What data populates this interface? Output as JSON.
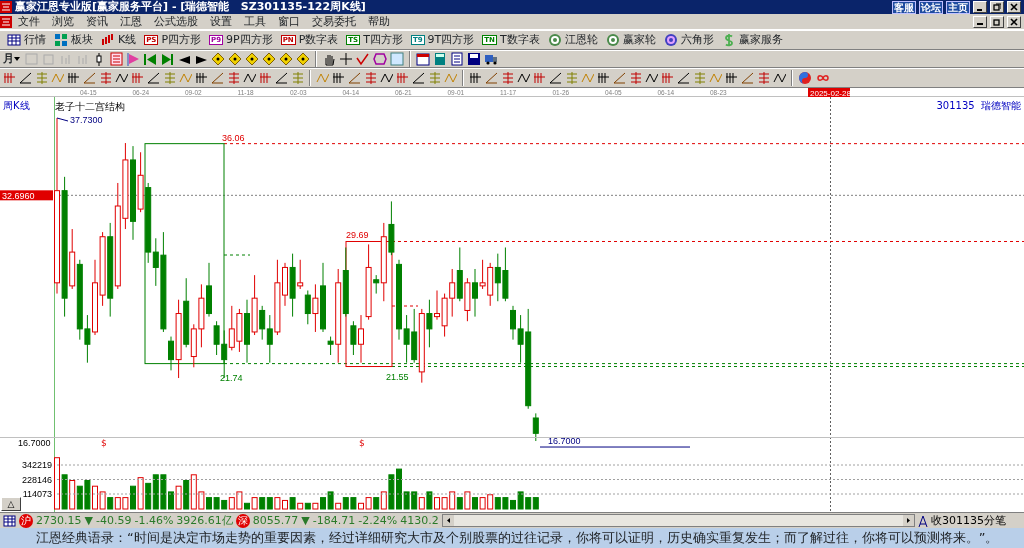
{
  "window": {
    "title": "赢家江恩专业版[赢家服务平台] - [瑞德智能   SZ301135-122周K线]",
    "links": [
      "客服",
      "论坛",
      "主页"
    ]
  },
  "menu": [
    "文件",
    "浏览",
    "资讯",
    "江恩",
    "公式选股",
    "设置",
    "工具",
    "窗口",
    "交易委托",
    "帮助"
  ],
  "toolbar": [
    {
      "kind": "grid",
      "label": "行情"
    },
    {
      "kind": "blocks",
      "label": "板块"
    },
    {
      "kind": "candles",
      "label": "K线"
    },
    {
      "kind": "badge",
      "badge": "PS",
      "color": "#c00000",
      "label": "P四方形"
    },
    {
      "kind": "badge",
      "badge": "P9",
      "color": "#a000a0",
      "label": "9P四方形"
    },
    {
      "kind": "badge",
      "badge": "PN",
      "color": "#c00000",
      "label": "P数字表"
    },
    {
      "kind": "badge",
      "badge": "TS",
      "color": "#008000",
      "label": "T四方形"
    },
    {
      "kind": "badge",
      "badge": "T9",
      "color": "#008080",
      "label": "9T四方形"
    },
    {
      "kind": "badge",
      "badge": "TN",
      "color": "#008000",
      "label": "T数字表"
    },
    {
      "kind": "wheel",
      "label": "江恩轮"
    },
    {
      "kind": "wheel",
      "label": "赢家轮"
    },
    {
      "kind": "hexagon",
      "label": "六角形"
    },
    {
      "kind": "dollar",
      "label": "赢家服务"
    }
  ],
  "period": "月",
  "chart": {
    "period_label": "周K线",
    "dates": [
      "04-15",
      "06-24",
      "09-02",
      "11-18",
      "02-03",
      "04-14",
      "06-21",
      "09-01",
      "11-17",
      "01-26",
      "04-05",
      "06-14",
      "08-23"
    ],
    "cursor_date": "2025-02-28",
    "study_title": "老子十二宫结构",
    "symbol": "301135",
    "stock_name": "瑞德智能",
    "high_label": "37.7300",
    "low_label": "16.7000",
    "cursor_price": "32.6960",
    "boxes": [
      {
        "color": "#008000",
        "top_label": "36.06",
        "bottom_label": "21.74"
      },
      {
        "color": "#e00000",
        "top_label": "29.69",
        "bottom_label": "21.55"
      }
    ],
    "volume": {
      "top_label": "16.7000",
      "ticks": [
        "342219",
        "228146",
        "114073"
      ],
      "markers": [
        "$",
        "$"
      ],
      "toggle": "△"
    }
  },
  "status": {
    "indices": [
      {
        "badge": "沪",
        "value": "2730.15",
        "arrow": "▼",
        "change": "-40.59",
        "pct": "-1.46%",
        "amount": "3926.61亿"
      },
      {
        "badge": "深",
        "value": "8055.77",
        "arrow": "▼",
        "change": "-184.71",
        "pct": "-2.24%",
        "amount": "4130.2"
      }
    ],
    "right": "收301135分笔"
  },
  "quote": "江恩经典语录：“时间是决定市场走势的重要因素，经过详细研究大市及个别股票的过往记录，你将可以证明，历史确实重复发生；而了解过往，你将可以预测将来。”。"
}
